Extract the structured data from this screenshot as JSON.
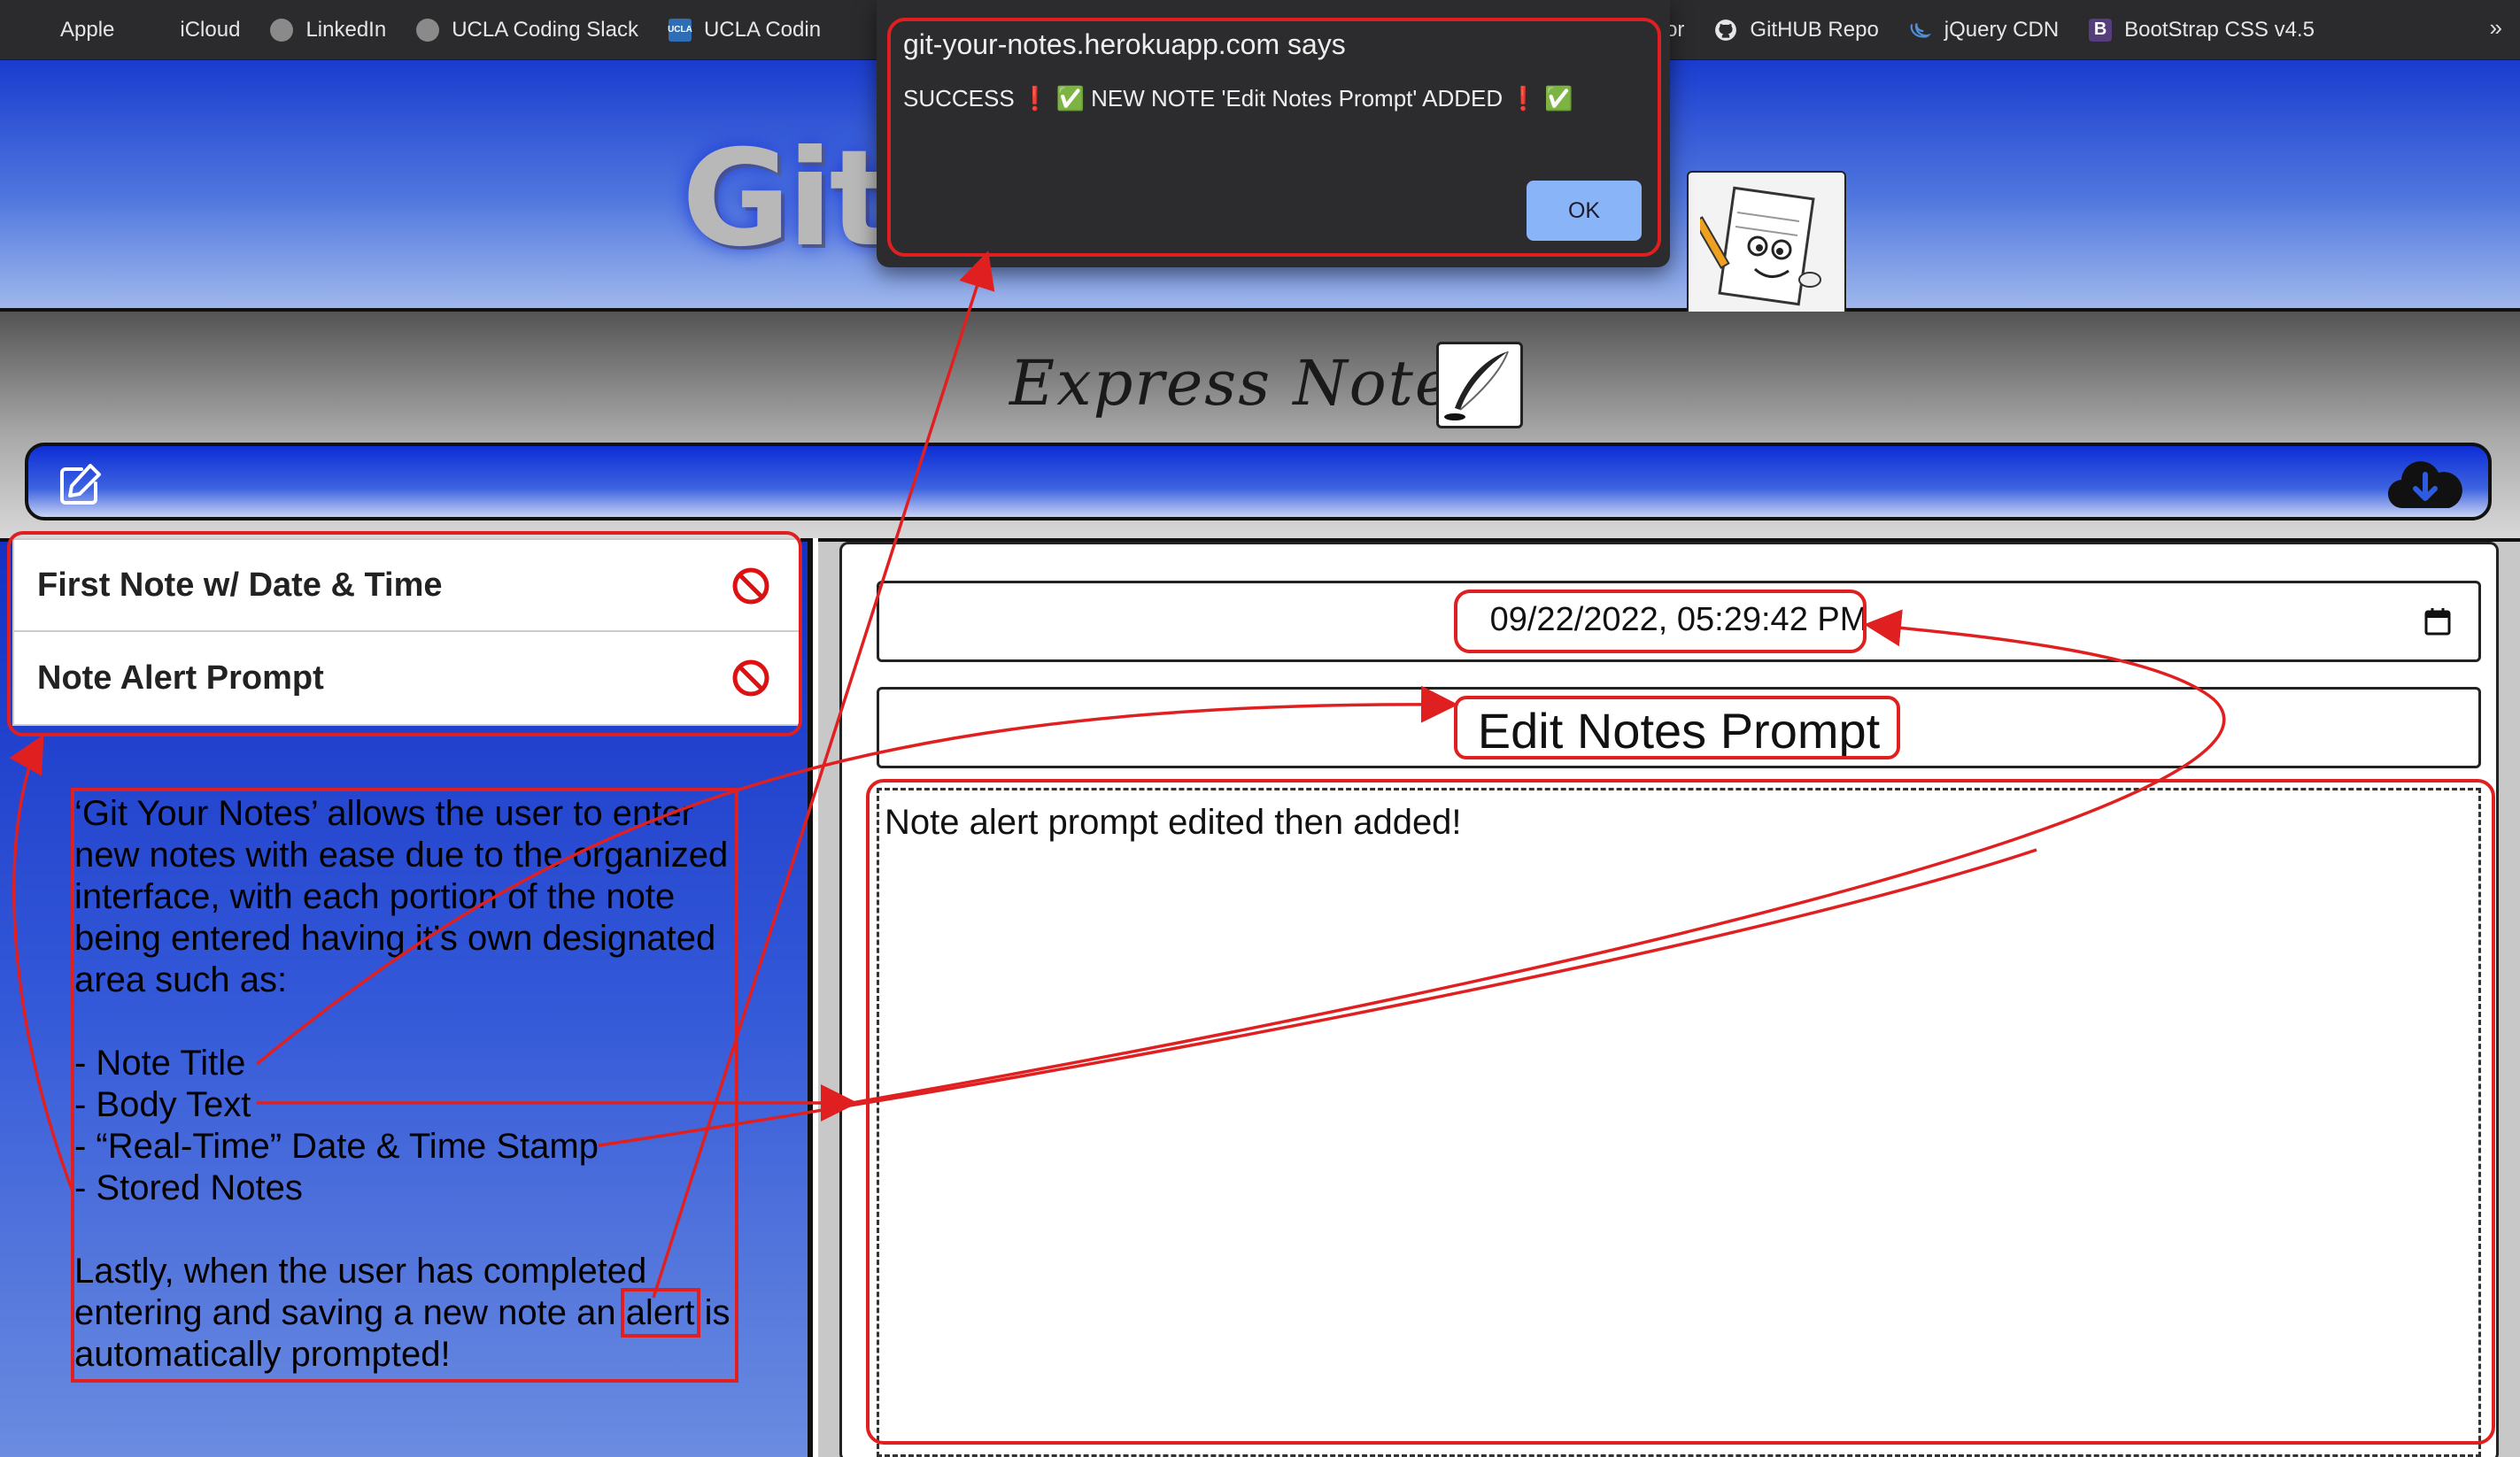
{
  "bookmarks": [
    {
      "label": "Apple",
      "icon": "apple-icon"
    },
    {
      "label": "iCloud",
      "icon": "apple-icon"
    },
    {
      "label": "LinkedIn",
      "icon": "globe-icon"
    },
    {
      "label": "UCLA Coding Slack",
      "icon": "globe-icon"
    },
    {
      "label": "UCLA Codin",
      "icon": "ucla-icon"
    },
    {
      "label": "ator",
      "icon": ""
    },
    {
      "label": "GitHUB Repo",
      "icon": "github-icon"
    },
    {
      "label": "jQuery CDN",
      "icon": "jquery-icon"
    },
    {
      "label": "BootStrap CSS v4.5",
      "icon": "bootstrap-icon"
    }
  ],
  "bookmarks_more": "»",
  "header": {
    "logo_text": "Git"
  },
  "app": {
    "title": "Express Notes"
  },
  "notes": [
    {
      "title": "First Note w/ Date & Time"
    },
    {
      "title": "Note Alert Prompt"
    }
  ],
  "description": {
    "intro": "‘Git Your Notes’ allows the user to enter new notes with ease due to the organized interface, with each portion of the note being entered having it’s own designated area such as:",
    "items": [
      "- Note Title",
      "- Body Text",
      "- “Real-Time” Date & Time Stamp",
      "- Stored Notes"
    ],
    "closing_before": "Lastly, when the user has completed entering and saving a new note an ",
    "closing_highlight": "alert",
    "closing_after": " is automatically prompted!"
  },
  "editor": {
    "datetime": "09/22/2022, 05:29:42 PM",
    "title": "Edit Notes Prompt",
    "body": "Note alert prompt edited then added!"
  },
  "alert": {
    "title": "git-your-notes.herokuapp.com says",
    "message": "SUCCESS ❗ ✅ NEW NOTE 'Edit Notes Prompt' ADDED ❗ ✅",
    "ok_label": "OK"
  },
  "colors": {
    "annotation": "#e02020",
    "header_blue": "#1a3ccf",
    "ok_button": "#8ab4f8"
  }
}
